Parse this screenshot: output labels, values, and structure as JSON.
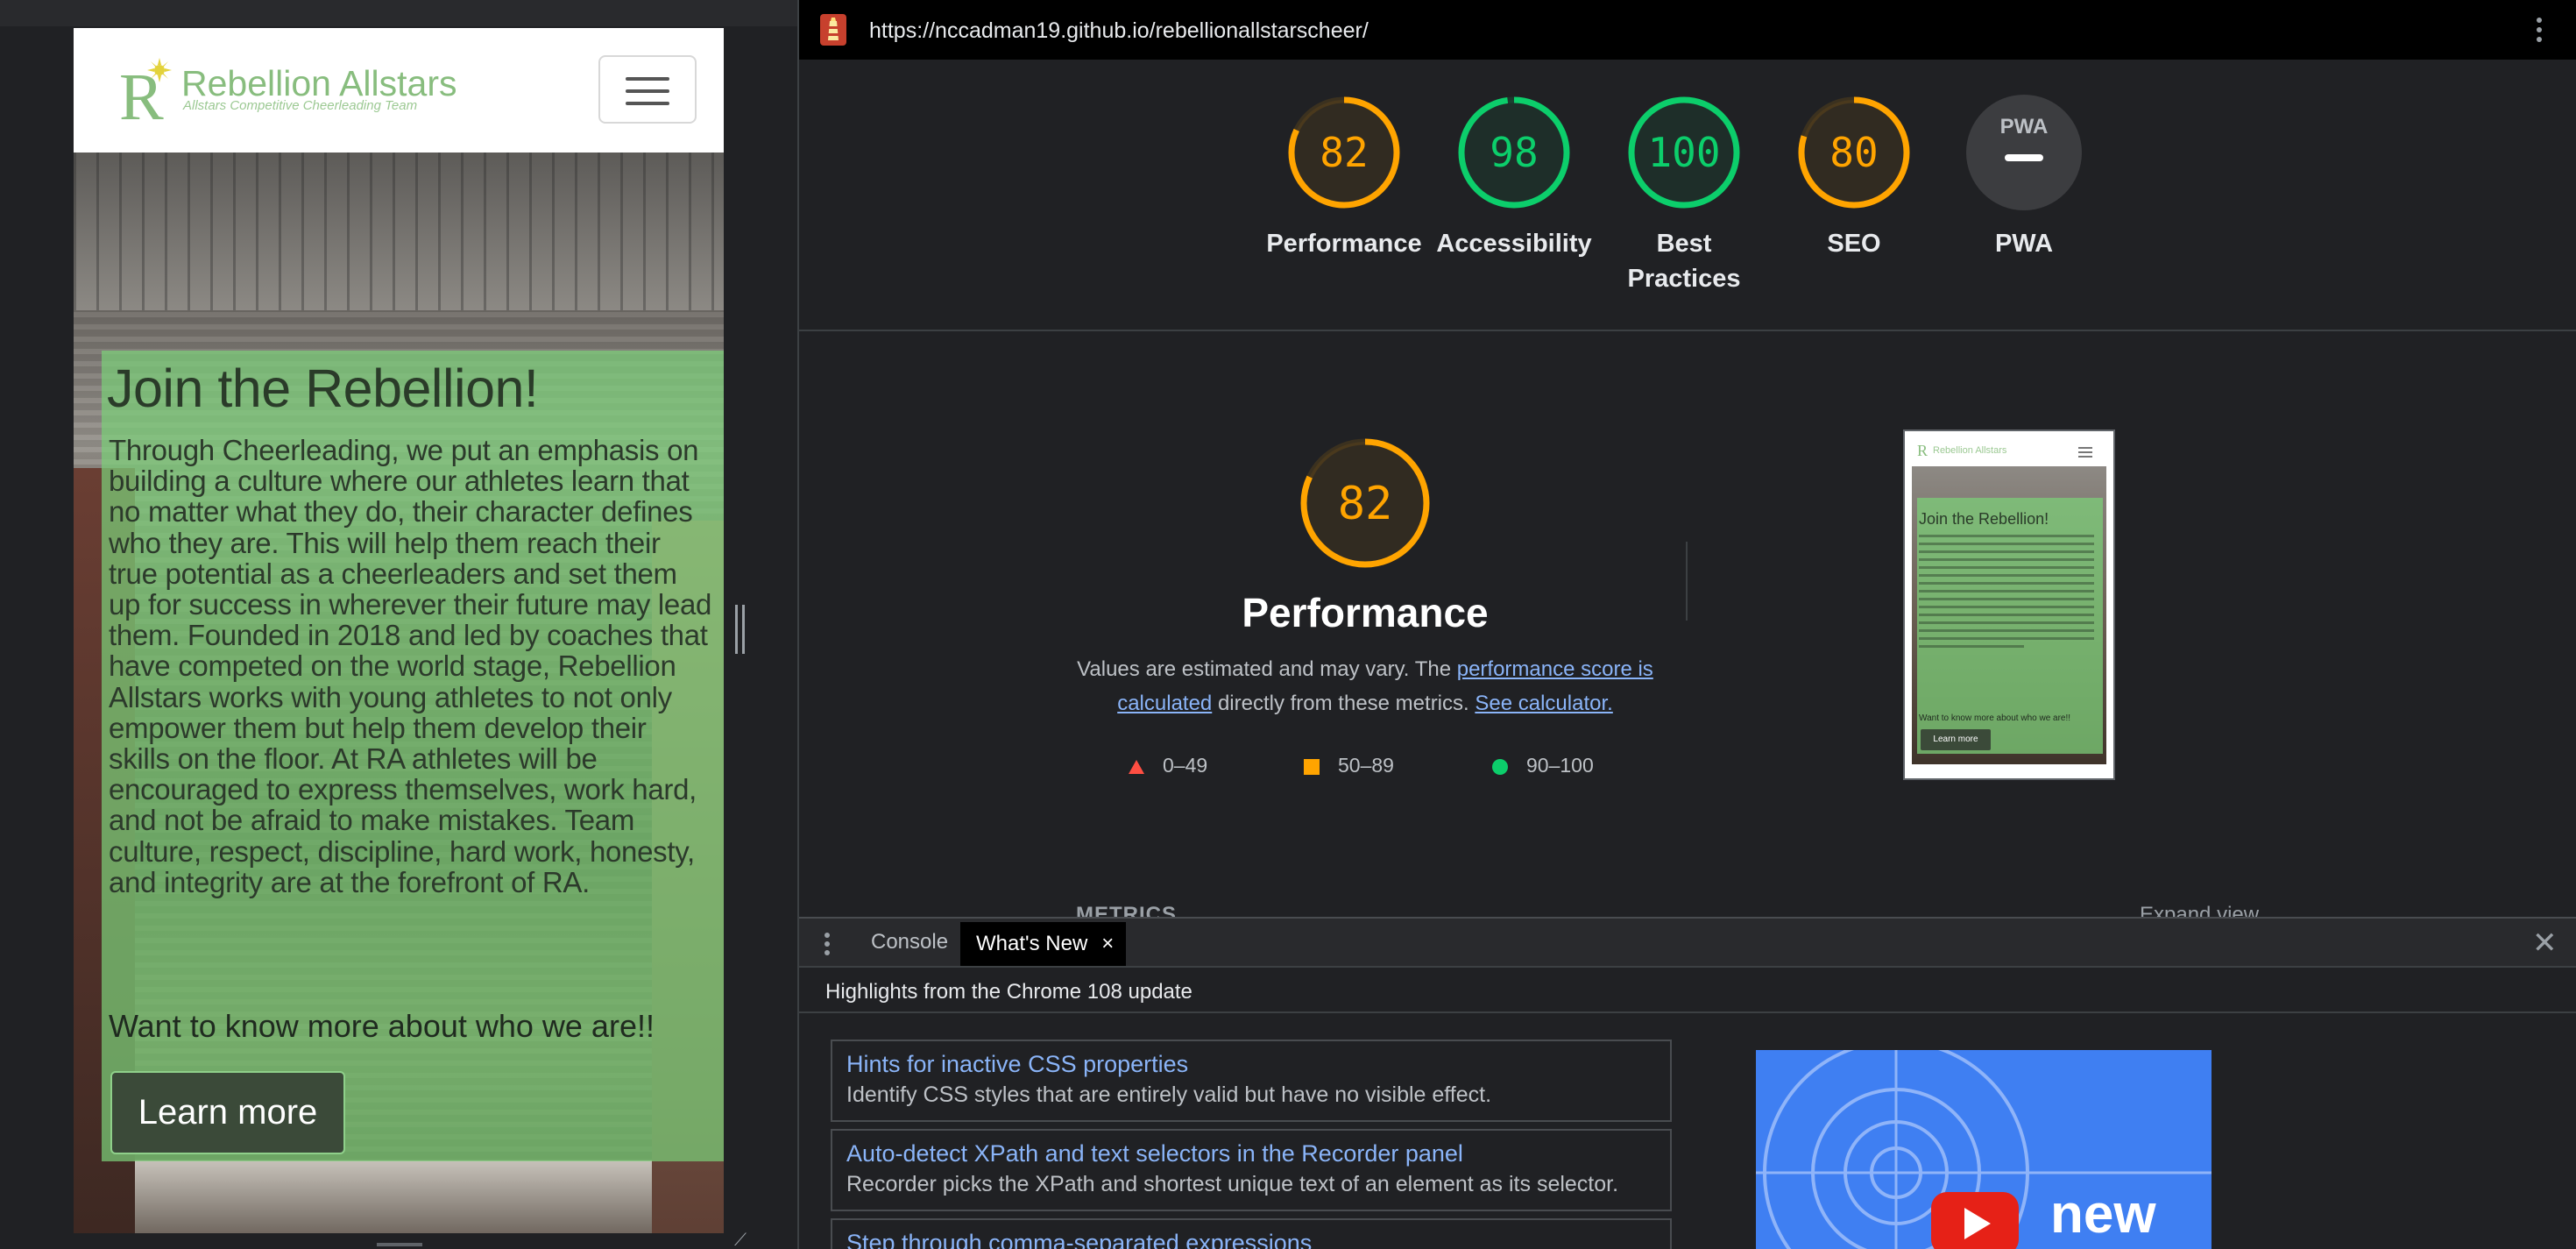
{
  "device": {
    "brand_initial": "R",
    "brand_name": "Rebellion Allstars",
    "brand_tagline": "Allstars Competitive Cheerleading Team",
    "hero_title": "Join the Rebellion!",
    "hero_text": "Through Cheerleading, we put an emphasis on building a culture where our athletes learn that no matter what they do, their character defines who they are. This will help them reach their true potential as a cheerleaders and set them up for success in wherever their future may lead them. Founded in 2018 and led by coaches that have competed on the world stage, Rebellion Allstars works with young athletes to not only empower them but help them develop their skills on the floor. At RA athletes will be encouraged to express themselves, work hard, and not be afraid to make mistakes. Team culture, respect, discipline, hard work, honesty, and integrity are at the forefront of RA.",
    "hero_question": "Want to know more about who we are!!",
    "learn_more": "Learn more"
  },
  "lighthouse": {
    "url": "https://nccadman19.github.io/rebellionallstarscheer/",
    "gauges": [
      {
        "label": "Performance",
        "score": "82",
        "value": 82,
        "color": "#ffa400"
      },
      {
        "label": "Accessibility",
        "score": "98",
        "value": 98,
        "color": "#0cce6b"
      },
      {
        "label": "Best Practices",
        "score": "100",
        "value": 100,
        "color": "#0cce6b"
      },
      {
        "label": "SEO",
        "score": "80",
        "value": 80,
        "color": "#ffa400"
      },
      {
        "label": "PWA",
        "score": "PWA",
        "value": null,
        "color": "#9aa0a6"
      }
    ],
    "performance": {
      "score": "82",
      "value": 82,
      "title": "Performance",
      "desc_prefix": "Values are estimated and may vary. The ",
      "link1": "performance score is calculated",
      "desc_middle": " directly from these metrics. ",
      "link2": "See calculator."
    },
    "legend": [
      {
        "range": "0–49",
        "shape": "triangle",
        "color": "#ff4e42"
      },
      {
        "range": "50–89",
        "shape": "square",
        "color": "#ffa400"
      },
      {
        "range": "90–100",
        "shape": "circle",
        "color": "#0cce6b"
      }
    ],
    "metrics_header": "METRICS",
    "expand_view": "Expand view"
  },
  "drawer": {
    "tabs": {
      "console": "Console",
      "whats_new": "What's New",
      "close_tab": "×"
    },
    "close": "✕",
    "highlights": "Highlights from the Chrome 108 update",
    "features": [
      {
        "title": "Hints for inactive CSS properties",
        "desc": "Identify CSS styles that are entirely valid but have no visible effect."
      },
      {
        "title": "Auto-detect XPath and text selectors in the Recorder panel",
        "desc": "Recorder picks the XPath and shortest unique text of an element as its selector."
      },
      {
        "title": "Step through comma-separated expressions",
        "desc": ""
      }
    ],
    "video_word": "new"
  }
}
